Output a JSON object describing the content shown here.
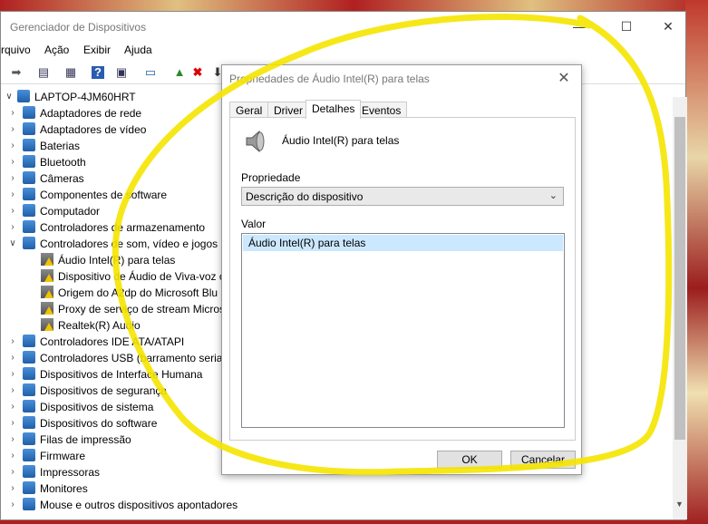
{
  "app": {
    "title": "Gerenciador de Dispositivos"
  },
  "window_controls": {
    "minimize": "—",
    "maximize": "☐",
    "close": "✕"
  },
  "menu": [
    "rquivo",
    "Ação",
    "Exibir",
    "Ajuda"
  ],
  "toolbar": [
    "back-icon",
    "properties-icon",
    "list-icon",
    "help-icon",
    "view-icon",
    "monitor-icon",
    "update-driver-icon",
    "uninstall-icon",
    "scan-icon"
  ],
  "tree": {
    "root": "LAPTOP-4JM60HRT",
    "items": [
      {
        "label": "Adaptadores de rede",
        "expanded": false,
        "child": false
      },
      {
        "label": "Adaptadores de vídeo",
        "expanded": false,
        "child": false
      },
      {
        "label": "Baterias",
        "expanded": false,
        "child": false
      },
      {
        "label": "Bluetooth",
        "expanded": false,
        "child": false
      },
      {
        "label": "Câmeras",
        "expanded": false,
        "child": false
      },
      {
        "label": "Componentes de software",
        "expanded": false,
        "child": false
      },
      {
        "label": "Computador",
        "expanded": false,
        "child": false
      },
      {
        "label": "Controladores de armazenamento",
        "expanded": false,
        "child": false
      },
      {
        "label": "Controladores de som, vídeo e jogos",
        "expanded": true,
        "child": false
      },
      {
        "label": "Áudio Intel(R) para telas",
        "expanded": false,
        "child": true
      },
      {
        "label": "Dispositivo de Áudio de Viva-voz c",
        "expanded": false,
        "child": true
      },
      {
        "label": "Origem do A2dp do Microsoft Blu",
        "expanded": false,
        "child": true
      },
      {
        "label": "Proxy de serviço de stream Micros",
        "expanded": false,
        "child": true
      },
      {
        "label": "Realtek(R) Audio",
        "expanded": false,
        "child": true
      },
      {
        "label": "Controladores IDE ATA/ATAPI",
        "expanded": false,
        "child": false
      },
      {
        "label": "Controladores USB (barramento serial",
        "expanded": false,
        "child": false
      },
      {
        "label": "Dispositivos de Interface Humana",
        "expanded": false,
        "child": false
      },
      {
        "label": "Dispositivos de segurança",
        "expanded": false,
        "child": false
      },
      {
        "label": "Dispositivos de sistema",
        "expanded": false,
        "child": false
      },
      {
        "label": "Dispositivos do software",
        "expanded": false,
        "child": false
      },
      {
        "label": "Filas de impressão",
        "expanded": false,
        "child": false
      },
      {
        "label": "Firmware",
        "expanded": false,
        "child": false
      },
      {
        "label": "Impressoras",
        "expanded": false,
        "child": false
      },
      {
        "label": "Monitores",
        "expanded": false,
        "child": false
      },
      {
        "label": "Mouse e outros dispositivos apontadores",
        "expanded": false,
        "child": false
      }
    ]
  },
  "dialog": {
    "title": "Propriedades de Áudio Intel(R) para telas",
    "close": "✕",
    "tabs": [
      "Geral",
      "Driver",
      "Detalhes",
      "Eventos"
    ],
    "active_tab": "Detalhes",
    "device_name": "Áudio Intel(R) para telas",
    "property_label": "Propriedade",
    "property_value": "Descrição do dispositivo",
    "value_label": "Valor",
    "value_items": [
      "Áudio Intel(R) para telas"
    ],
    "ok": "OK",
    "cancel": "Cancelar"
  },
  "colors": {
    "annotation": "#f5e400",
    "selection": "#cce8ff",
    "warning": "#f2c200"
  }
}
